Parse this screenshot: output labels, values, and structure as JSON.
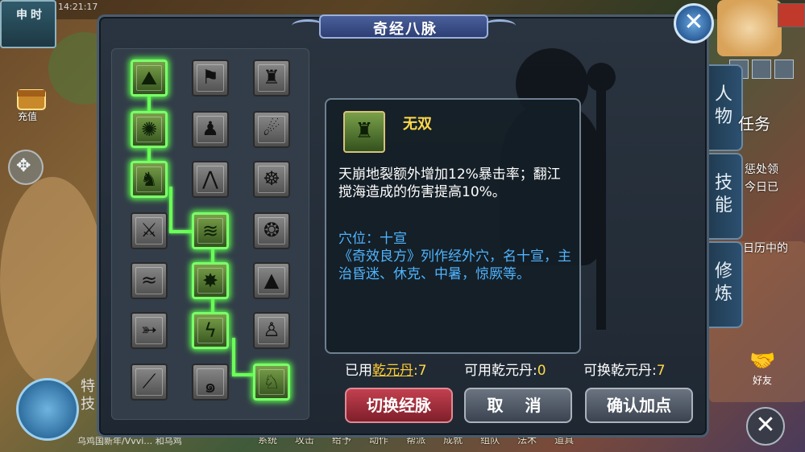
{
  "hud": {
    "time_label": "申时",
    "clock_text": "14:21:17",
    "recharge_label": "充值",
    "chat_text": "乌鸡国新年/Vvvi… 和乌鸡",
    "left_stub_text": "特\n技",
    "bottom_menu": [
      "系统",
      "攻击",
      "给予",
      "动作",
      "帮派",
      "成就",
      "组队",
      "法术",
      "道具"
    ],
    "side_tabs": [
      {
        "label": "人\n物"
      },
      {
        "label": "技\n能"
      },
      {
        "label": "修\n炼"
      }
    ],
    "side_texts": {
      "task": "任务",
      "penalty": "惩处领",
      "today": "今日已",
      "calendar": "日历中的"
    },
    "friends_label": "好友"
  },
  "dialog": {
    "title": "奇经八脉",
    "close_label": "✕"
  },
  "tree": {
    "nodes": [
      {
        "id": "n00",
        "icon": "mountain-wind-icon",
        "glyph": "⛰",
        "active": true
      },
      {
        "id": "n01",
        "icon": "banner-icon",
        "glyph": "⚑",
        "active": false
      },
      {
        "id": "n02",
        "icon": "warrior-shield-icon",
        "glyph": "♜",
        "active": false
      },
      {
        "id": "n10",
        "icon": "whirlwind-icon",
        "glyph": "✺",
        "active": true
      },
      {
        "id": "n11",
        "icon": "silhouette-icon",
        "glyph": "♟",
        "active": false
      },
      {
        "id": "n12",
        "icon": "comet-icon",
        "glyph": "☄",
        "active": false
      },
      {
        "id": "n20",
        "icon": "roaring-warrior-icon",
        "glyph": "♞",
        "active": true
      },
      {
        "id": "n21",
        "icon": "flame-arch-icon",
        "glyph": "⋀",
        "active": false
      },
      {
        "id": "n22",
        "icon": "meditating-figure-icon",
        "glyph": "☸",
        "active": false
      },
      {
        "id": "n30",
        "icon": "crossed-blades-icon",
        "glyph": "⚔",
        "active": false
      },
      {
        "id": "n31",
        "icon": "storm-slash-icon",
        "glyph": "≋",
        "active": true
      },
      {
        "id": "n32",
        "icon": "swirling-orbs-icon",
        "glyph": "❂",
        "active": false
      },
      {
        "id": "n40",
        "icon": "waves-icon",
        "glyph": "≈",
        "active": false
      },
      {
        "id": "n41",
        "icon": "burst-figure-icon",
        "glyph": "✸",
        "active": true
      },
      {
        "id": "n42",
        "icon": "cloaked-figure-icon",
        "glyph": "▲",
        "active": false
      },
      {
        "id": "n50",
        "icon": "triple-arrow-icon",
        "glyph": "➳",
        "active": false
      },
      {
        "id": "n51",
        "icon": "lightning-strike-icon",
        "glyph": "ϟ",
        "active": true
      },
      {
        "id": "n52",
        "icon": "kneeling-figure-icon",
        "glyph": "♙",
        "active": false
      },
      {
        "id": "n60",
        "icon": "claw-slash-icon",
        "glyph": "⟋",
        "active": false
      },
      {
        "id": "n61",
        "icon": "spiral-icon",
        "glyph": "๑",
        "active": false
      },
      {
        "id": "n62",
        "icon": "spear-warrior-icon",
        "glyph": "♘",
        "active": true
      }
    ]
  },
  "detail": {
    "icon": "warrior-shield-icon",
    "icon_glyph": "♜",
    "skill_name": "无双",
    "description": "天崩地裂额外增加12%暴击率；翻江搅海造成的伤害提高10%。",
    "acupoint": "穴位：十宣\n《奇效良方》列作经外穴，名十宣，主治昏迷、休克、中暑，惊厥等。"
  },
  "stats": {
    "used_label": "已用",
    "used_item": "乾元丹",
    "used_value": ":7",
    "available_label": "可用乾元丹:",
    "available_value": "0",
    "exchangeable_label": "可换乾元丹:",
    "exchangeable_value": "7"
  },
  "buttons": {
    "switch": "切换经脉",
    "cancel": "取 消",
    "confirm": "确认加点"
  },
  "colors": {
    "active_glow": "#5cff4a",
    "skill_name": "#ffd84a",
    "acupoint_text": "#4fb4ff",
    "switch_button": "#a8303c"
  }
}
